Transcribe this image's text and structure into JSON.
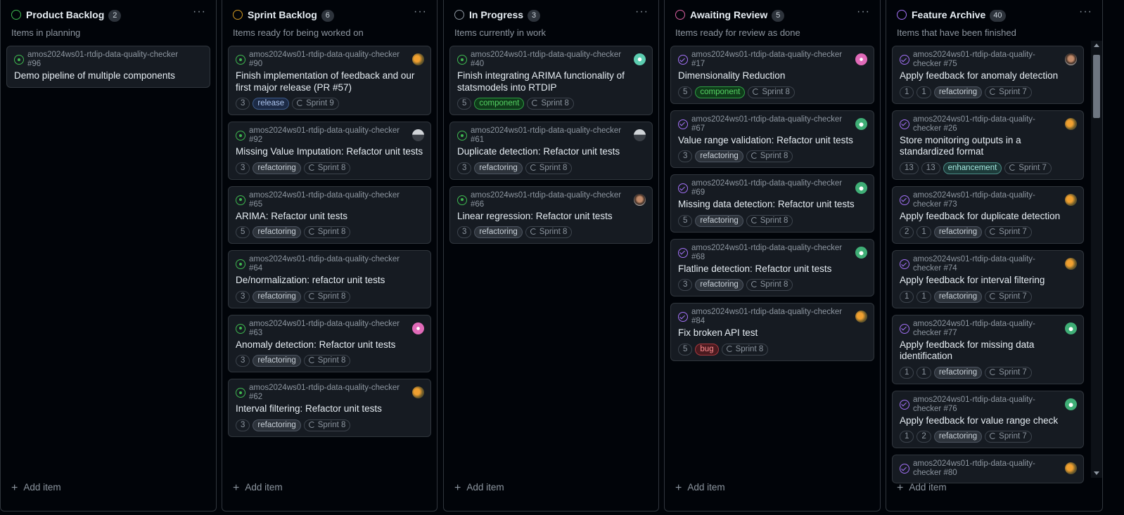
{
  "colors": {
    "bg": "#010409",
    "card_bg": "#161b22",
    "border": "#30363d",
    "status_green": "#3fb950",
    "status_orange": "#d29922",
    "status_grey": "#8d96a0",
    "status_pink": "#db61a2",
    "status_purple": "#a371f7"
  },
  "add_item_label": "Add item",
  "columns": [
    {
      "title": "Product Backlog",
      "count": "2",
      "description": "Items in planning",
      "status_color": "#3fb950",
      "cards": [
        {
          "repo": "amos2024ws01-rtdip-data-quality-checker #96",
          "title": "Demo pipeline of multiple components",
          "icon": "open"
        }
      ]
    },
    {
      "title": "Sprint Backlog",
      "count": "6",
      "description": "Items ready for being worked on",
      "status_color": "#d29922",
      "cards": [
        {
          "repo": "amos2024ws01-rtdip-data-quality-checker #90",
          "title": "Finish implementation of feedback and our first major release (PR #57)",
          "icon": "open",
          "avatar": "av-orange",
          "estimate": "3",
          "label": "release",
          "sprint": "Sprint 9"
        },
        {
          "repo": "amos2024ws01-rtdip-data-quality-checker #92",
          "title": "Missing Value Imputation: Refactor unit tests",
          "icon": "open",
          "avatar": "av-grey",
          "estimate": "3",
          "label": "refactoring",
          "sprint": "Sprint 8"
        },
        {
          "repo": "amos2024ws01-rtdip-data-quality-checker #65",
          "title": "ARIMA: Refactor unit tests",
          "icon": "open",
          "estimate": "5",
          "label": "refactoring",
          "sprint": "Sprint 8"
        },
        {
          "repo": "amos2024ws01-rtdip-data-quality-checker #64",
          "title": "De/normalization: refactor unit tests",
          "icon": "open",
          "estimate": "3",
          "label": "refactoring",
          "sprint": "Sprint 8"
        },
        {
          "repo": "amos2024ws01-rtdip-data-quality-checker #63",
          "title": "Anomaly detection: Refactor unit tests",
          "icon": "open",
          "avatar": "av-pink",
          "estimate": "3",
          "label": "refactoring",
          "sprint": "Sprint 8"
        },
        {
          "repo": "amos2024ws01-rtdip-data-quality-checker #62",
          "title": "Interval filtering: Refactor unit tests",
          "icon": "open",
          "avatar": "av-orange",
          "estimate": "3",
          "label": "refactoring",
          "sprint": "Sprint 8"
        }
      ]
    },
    {
      "title": "In Progress",
      "count": "3",
      "description": "Items currently in work",
      "status_color": "#8d96a0",
      "cards": [
        {
          "repo": "amos2024ws01-rtdip-data-quality-checker #40",
          "title": "Finish integrating ARIMA functionality of statsmodels into RTDIP",
          "icon": "open",
          "avatar": "av-teal",
          "estimate": "5",
          "label": "component",
          "sprint": "Sprint 8"
        },
        {
          "repo": "amos2024ws01-rtdip-data-quality-checker #61",
          "title": "Duplicate detection: Refactor unit tests",
          "icon": "open",
          "avatar": "av-grey",
          "estimate": "3",
          "label": "refactoring",
          "sprint": "Sprint 8"
        },
        {
          "repo": "amos2024ws01-rtdip-data-quality-checker #66",
          "title": "Linear regression: Refactor unit tests",
          "icon": "open",
          "avatar": "av-photo",
          "estimate": "3",
          "label": "refactoring",
          "sprint": "Sprint 8"
        }
      ]
    },
    {
      "title": "Awaiting Review",
      "count": "5",
      "description": "Items ready for review as done",
      "status_color": "#db61a2",
      "cards": [
        {
          "repo": "amos2024ws01-rtdip-data-quality-checker #17",
          "title": "Dimensionality Reduction",
          "icon": "done",
          "avatar": "av-pink",
          "estimate": "5",
          "label": "component",
          "sprint": "Sprint 8"
        },
        {
          "repo": "amos2024ws01-rtdip-data-quality-checker #67",
          "title": "Value range validation: Refactor unit tests",
          "icon": "done",
          "avatar": "av-green",
          "estimate": "3",
          "label": "refactoring",
          "sprint": "Sprint 8"
        },
        {
          "repo": "amos2024ws01-rtdip-data-quality-checker #69",
          "title": "Missing data detection: Refactor unit tests",
          "icon": "done",
          "avatar": "av-green",
          "estimate": "5",
          "label": "refactoring",
          "sprint": "Sprint 8"
        },
        {
          "repo": "amos2024ws01-rtdip-data-quality-checker #68",
          "title": "Flatline detection: Refactor unit tests",
          "icon": "done",
          "avatar": "av-green",
          "estimate": "3",
          "label": "refactoring",
          "sprint": "Sprint 8"
        },
        {
          "repo": "amos2024ws01-rtdip-data-quality-checker #84",
          "title": "Fix broken API test",
          "icon": "done",
          "avatar": "av-orange",
          "estimate": "5",
          "label": "bug",
          "sprint": "Sprint 8"
        }
      ]
    },
    {
      "title": "Feature Archive",
      "count": "40",
      "description": "Items that have been finished",
      "status_color": "#a371f7",
      "cards": [
        {
          "repo": "amos2024ws01-rtdip-data-quality-checker #75",
          "title": "Apply feedback for anomaly detection",
          "icon": "done",
          "avatar": "av-photo",
          "estimate": "1",
          "estimate2": "1",
          "label": "refactoring",
          "sprint": "Sprint 7"
        },
        {
          "repo": "amos2024ws01-rtdip-data-quality-checker #26",
          "title": "Store monitoring outputs in a standardized format",
          "icon": "done",
          "avatar": "av-orange",
          "estimate": "13",
          "estimate2": "13",
          "label": "enhancement",
          "sprint": "Sprint 7"
        },
        {
          "repo": "amos2024ws01-rtdip-data-quality-checker #73",
          "title": "Apply feedback for duplicate detection",
          "icon": "done",
          "avatar": "av-orange",
          "estimate": "2",
          "estimate2": "1",
          "label": "refactoring",
          "sprint": "Sprint 7"
        },
        {
          "repo": "amos2024ws01-rtdip-data-quality-checker #74",
          "title": "Apply feedback for interval filtering",
          "icon": "done",
          "avatar": "av-orange",
          "estimate": "1",
          "estimate2": "1",
          "label": "refactoring",
          "sprint": "Sprint 7"
        },
        {
          "repo": "amos2024ws01-rtdip-data-quality-checker #77",
          "title": "Apply feedback for missing data identification",
          "icon": "done",
          "avatar": "av-green",
          "estimate": "1",
          "estimate2": "1",
          "label": "refactoring",
          "sprint": "Sprint 7"
        },
        {
          "repo": "amos2024ws01-rtdip-data-quality-checker #76",
          "title": "Apply feedback for value range check",
          "icon": "done",
          "avatar": "av-green",
          "estimate": "1",
          "estimate2": "2",
          "label": "refactoring",
          "sprint": "Sprint 7"
        },
        {
          "repo": "amos2024ws01-rtdip-data-quality-checker #80",
          "title": "",
          "icon": "done",
          "avatar": "av-orange"
        }
      ]
    }
  ]
}
